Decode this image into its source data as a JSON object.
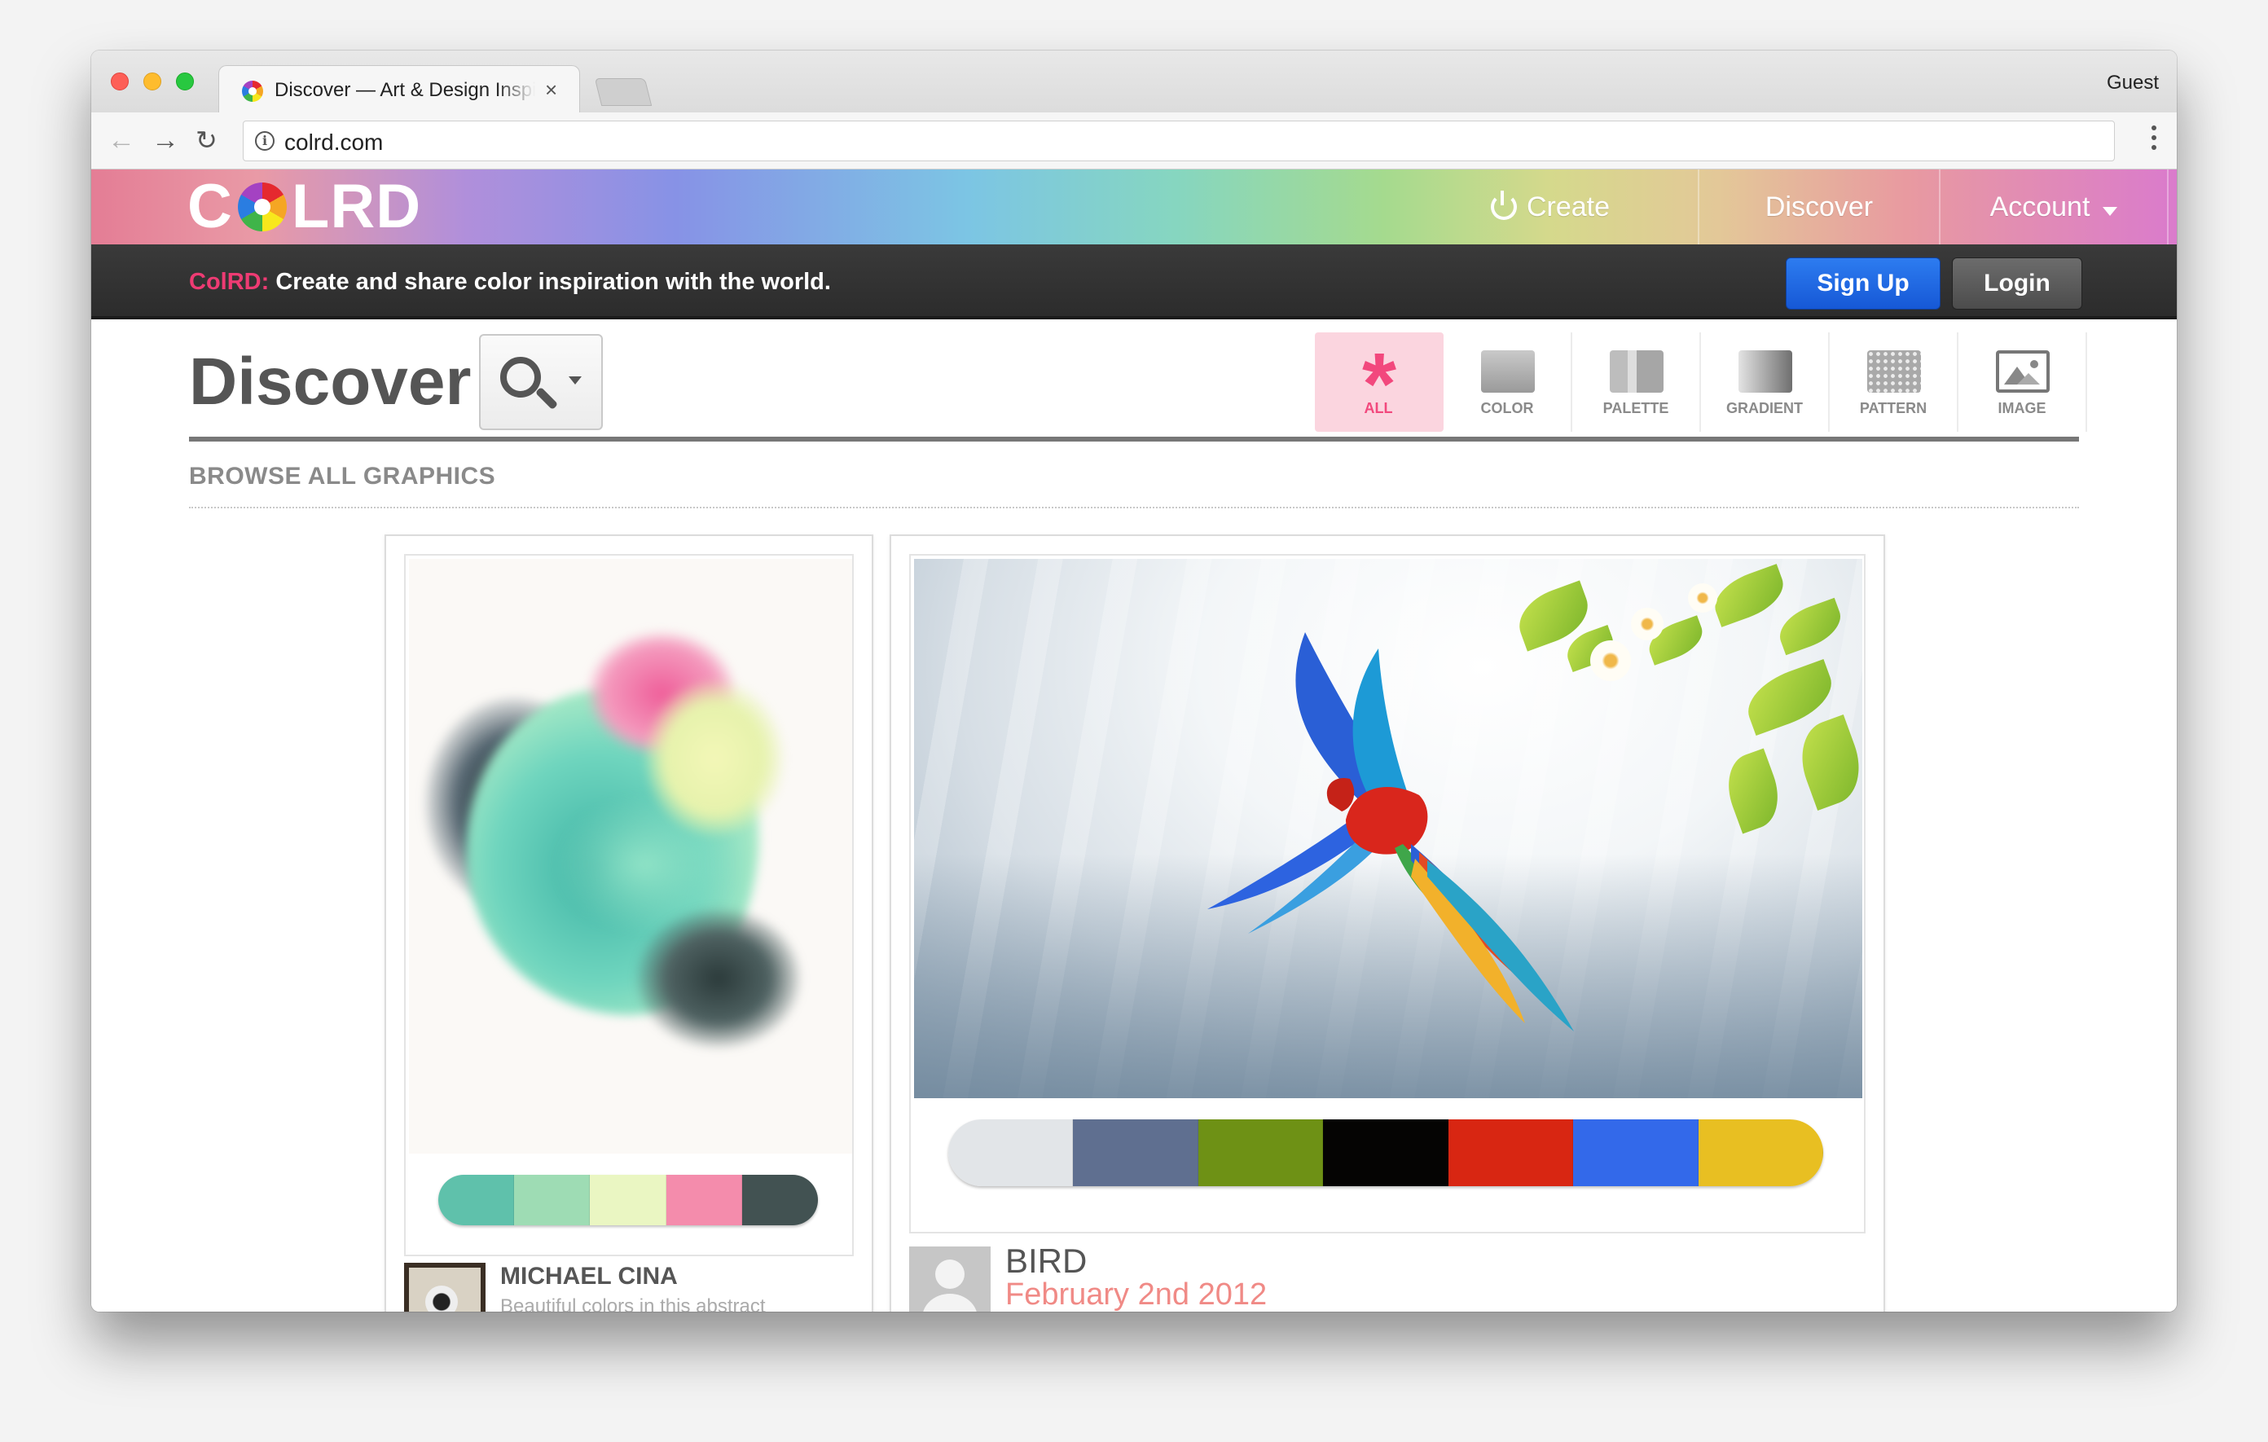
{
  "browser": {
    "tab_title": "Discover — Art & Design Inspiration",
    "tab_close": "×",
    "profile": "Guest",
    "url": "colrd.com",
    "info_glyph": "i",
    "back_glyph": "←",
    "forward_glyph": "→",
    "reload_glyph": "↻"
  },
  "site": {
    "logo_left": "C",
    "logo_right": "LRD",
    "nav": {
      "create": "Create",
      "discover": "Discover",
      "account": "Account"
    },
    "tagline_brand": "ColRD:",
    "tagline_text": " Create and share color inspiration with the world.",
    "signup": "Sign Up",
    "login": "Login"
  },
  "discover": {
    "title": "Discover",
    "filters": [
      {
        "label": "ALL",
        "active": true
      },
      {
        "label": "COLOR"
      },
      {
        "label": "PALETTE"
      },
      {
        "label": "GRADIENT"
      },
      {
        "label": "PATTERN"
      },
      {
        "label": "IMAGE"
      }
    ],
    "asterisk": "*",
    "browse_heading": "BROWSE ALL GRAPHICS"
  },
  "cards": [
    {
      "author": "MICHAEL CINA",
      "description": "Beautiful colors in this abstract",
      "palette": [
        "#5fc1ab",
        "#9edcb4",
        "#eaf6c2",
        "#f48cac",
        "#425252"
      ]
    },
    {
      "title": "BIRD",
      "date": "February 2nd 2012",
      "palette": [
        "#e2e5e8",
        "#5f6f90",
        "#6e9115",
        "#050403",
        "#d82612",
        "#3369ea",
        "#e8bf22"
      ]
    }
  ],
  "colors": {
    "brand_pink": "#ee3b73",
    "signup_blue": "#1f6be3",
    "date_salmon": "#f08a86"
  }
}
